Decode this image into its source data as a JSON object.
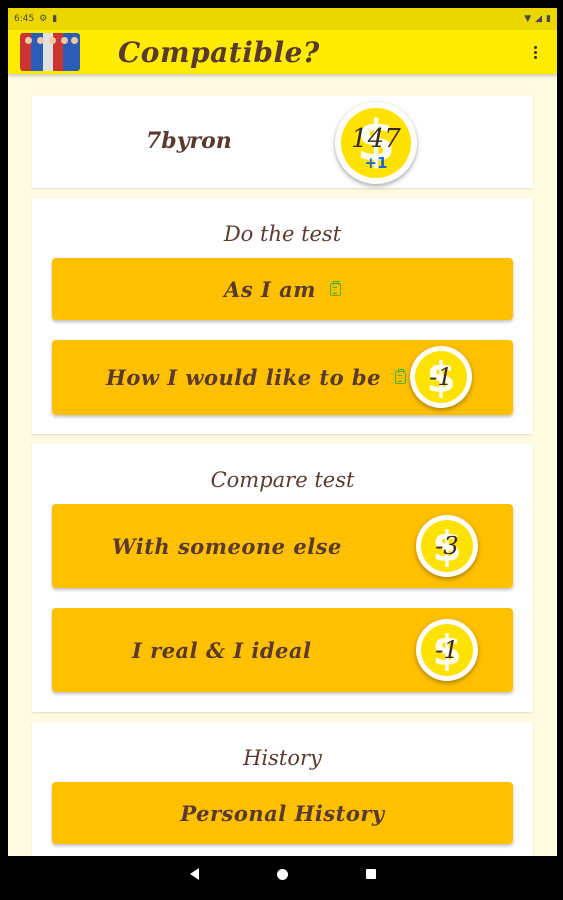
{
  "status_bar": {
    "time": "6:45",
    "icons": [
      "settings-icon",
      "sim-icon",
      "wifi-icon",
      "signal-icon",
      "battery-icon"
    ]
  },
  "app_bar": {
    "title": "Compatible?",
    "menu_icon": "more-vert-icon"
  },
  "user": {
    "name": "7byron",
    "coins": "147",
    "coins_delta": "+1"
  },
  "sections": {
    "do_test": {
      "title": "Do the test",
      "as_i_am": {
        "label": "As I am"
      },
      "would_like": {
        "label": "How I would like to be",
        "cost": "-1"
      }
    },
    "compare": {
      "title": "Compare test",
      "someone_else": {
        "label": "With someone else",
        "cost": "-3"
      },
      "real_ideal": {
        "label": "I real & I ideal",
        "cost": "-1"
      }
    },
    "history": {
      "title": "History",
      "personal": {
        "label": "Personal History"
      }
    }
  },
  "colors": {
    "app_bar": "#ffec00",
    "button": "#ffc000",
    "text": "#5a3a2e",
    "coin": "#ffe200",
    "background": "#fffbe0"
  },
  "nav": {
    "icons": [
      "back-icon",
      "home-icon",
      "recents-icon"
    ]
  }
}
